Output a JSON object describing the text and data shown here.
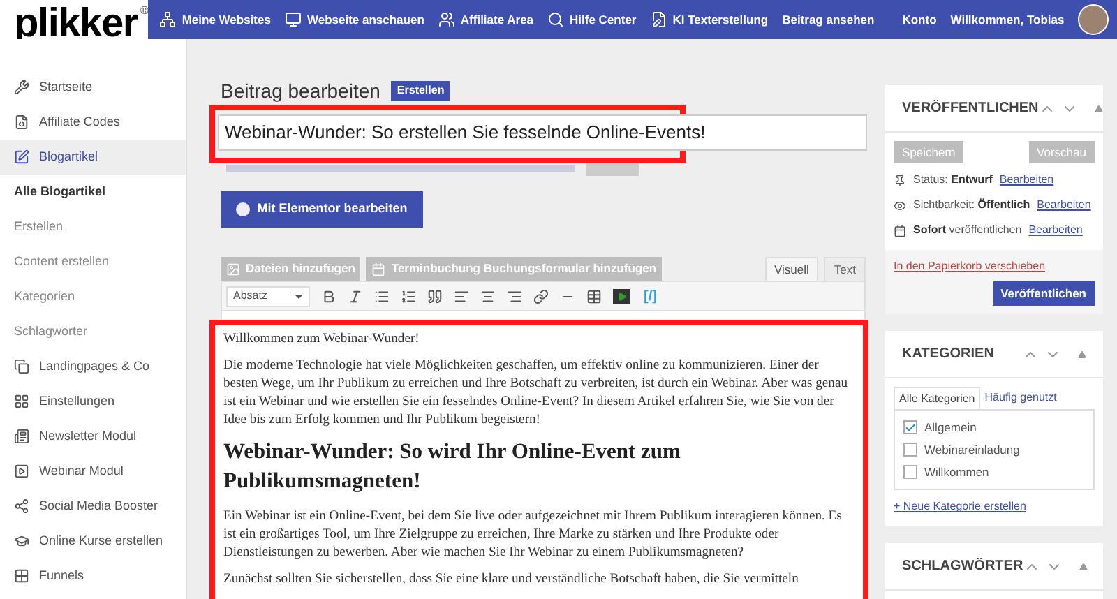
{
  "logo": {
    "text": "plikker",
    "mark": "®"
  },
  "topnav": {
    "items": [
      {
        "label": "Meine Websites"
      },
      {
        "label": "Webseite anschauen"
      },
      {
        "label": "Affiliate Area"
      },
      {
        "label": "Hilfe Center"
      },
      {
        "label": "KI Texterstellung"
      },
      {
        "label": "Beitrag ansehen"
      }
    ],
    "account": "Konto",
    "welcome": "Willkommen, Tobias"
  },
  "sidebar": {
    "items": [
      {
        "label": "Startseite",
        "kind": "main",
        "selected": false
      },
      {
        "label": "Affiliate Codes",
        "kind": "main",
        "selected": false
      },
      {
        "label": "Blogartikel",
        "kind": "main",
        "selected": true
      },
      {
        "label": "Alle Blogartikel",
        "kind": "sub",
        "selected": true
      },
      {
        "label": "Erstellen",
        "kind": "sub",
        "selected": false
      },
      {
        "label": "Content erstellen",
        "kind": "sub",
        "selected": false
      },
      {
        "label": "Kategorien",
        "kind": "sub",
        "selected": false
      },
      {
        "label": "Schlagwörter",
        "kind": "sub",
        "selected": false
      },
      {
        "label": "Landingpages & Co",
        "kind": "main",
        "selected": false
      },
      {
        "label": "Einstellungen",
        "kind": "main",
        "selected": false
      },
      {
        "label": "Newsletter Modul",
        "kind": "main",
        "selected": false
      },
      {
        "label": "Webinar Modul",
        "kind": "main",
        "selected": false
      },
      {
        "label": "Social Media Booster",
        "kind": "main",
        "selected": false
      },
      {
        "label": "Online Kurse erstellen",
        "kind": "main",
        "selected": false
      },
      {
        "label": "Funnels",
        "kind": "main",
        "selected": false
      }
    ]
  },
  "editor": {
    "heading": "Beitrag bearbeiten",
    "badge": "Erstellen",
    "title_value": "Webinar-Wunder: So erstellen Sie fesselnde Online-Events!",
    "elementor_button": "Mit Elementor bearbeiten",
    "media_buttons": [
      "Dateien hinzufügen",
      "Terminbuchung Buchungsformular hinzufügen"
    ],
    "tabs": [
      {
        "label": "Visuell",
        "selected": true
      },
      {
        "label": "Text",
        "selected": false
      }
    ],
    "format_select": "Absatz",
    "shortcode_button": "[/]",
    "content": [
      {
        "kind": "p",
        "text": "Willkommen zum Webinar-Wunder!"
      },
      {
        "kind": "p",
        "text": "Die moderne Technologie hat viele Möglichkeiten geschaffen, um effektiv online zu kommunizieren. Einer der besten Wege, um Ihr Publikum zu erreichen und Ihre Botschaft zu verbreiten, ist durch ein Webinar. Aber was genau ist ein Webinar und wie erstellen Sie ein fesselndes Online-Event? In diesem Artikel erfahren Sie, wie Sie von der Idee bis zum Erfolg kommen und Ihr Publikum begeistern!"
      },
      {
        "kind": "h2",
        "text": "Webinar-Wunder: So wird Ihr Online-Event zum Publikumsmagneten!"
      },
      {
        "kind": "p",
        "text": "Ein Webinar ist ein Online-Event, bei dem Sie live oder aufgezeichnet mit Ihrem Publikum interagieren können. Es ist ein großartiges Tool, um Ihre Zielgruppe zu erreichen, Ihre Marke zu stärken und Ihre Produkte oder Dienstleistungen zu bewerben. Aber wie machen Sie Ihr Webinar zu einem Publikumsmagneten?"
      },
      {
        "kind": "p",
        "text": "Zunächst sollten Sie sicherstellen, dass Sie eine klare und verständliche Botschaft haben, die Sie vermitteln"
      }
    ]
  },
  "publish": {
    "title": "VERÖFFENTLICHEN",
    "save": "Speichern",
    "preview": "Vorschau",
    "rows": [
      {
        "label": "Status:",
        "value": "Entwurf",
        "link": "Bearbeiten"
      },
      {
        "label": "Sichtbarkeit:",
        "value": "Öffentlich",
        "link": "Bearbeiten"
      },
      {
        "value": "Sofort",
        "label": "veröffentlichen",
        "link": "Bearbeiten"
      }
    ],
    "trash": "In den Papierkorb verschieben",
    "publish_button": "Veröffentlichen"
  },
  "categories": {
    "title": "KATEGORIEN",
    "tabs": [
      {
        "label": "Alle Kategorien",
        "selected": true
      },
      {
        "label": "Häufig genutzt",
        "selected": false
      }
    ],
    "items": [
      {
        "label": "Allgemein",
        "checked": true
      },
      {
        "label": "Webinareinladung",
        "checked": false
      },
      {
        "label": "Willkommen",
        "checked": false
      }
    ],
    "add_link": "+ Neue Kategorie erstellen"
  },
  "tags": {
    "title": "SCHLAGWÖRTER"
  }
}
